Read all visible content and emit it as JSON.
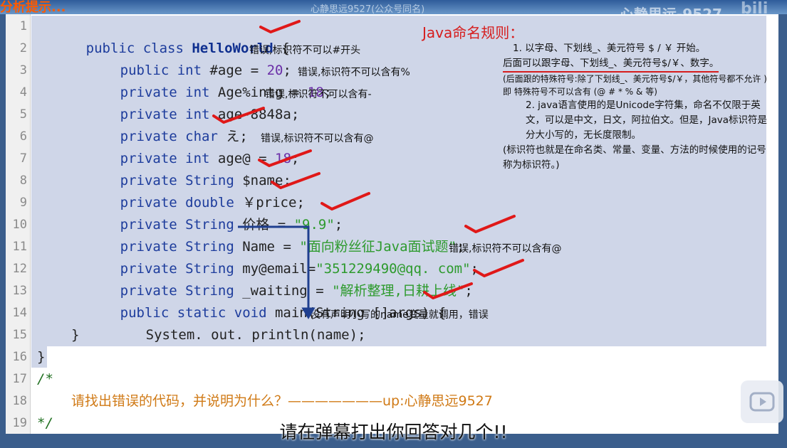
{
  "header": {
    "partial_title": "分析提示...",
    "watermark_center": "心静思远9527(公众号同名)",
    "watermark_right": "心静思远-9527",
    "watermark_logo": "bili"
  },
  "code_lines": [
    {
      "ln": "1"
    },
    {
      "ln": "2"
    },
    {
      "ln": "3"
    },
    {
      "ln": "4"
    },
    {
      "ln": "5"
    },
    {
      "ln": "6"
    },
    {
      "ln": "7"
    },
    {
      "ln": "8"
    },
    {
      "ln": "9"
    },
    {
      "ln": "10"
    },
    {
      "ln": "11"
    },
    {
      "ln": "12"
    },
    {
      "ln": "13"
    },
    {
      "ln": "14"
    },
    {
      "ln": "15"
    },
    {
      "ln": "16"
    },
    {
      "ln": "17"
    },
    {
      "ln": "18"
    },
    {
      "ln": "19"
    }
  ],
  "code": {
    "l1": {
      "a": "public class ",
      "b": "HelloWorld",
      "c": " {"
    },
    "l2": {
      "a": "public int ",
      "b": "#age",
      "c": " = ",
      "d": "20",
      "e": ";"
    },
    "l3": {
      "a": "private int ",
      "b": "Age%intg",
      "c": " = ",
      "d": "18",
      "e": ";"
    },
    "l4": {
      "a": "private int ",
      "b": "age-8848a",
      "c": ";"
    },
    "l5": {
      "a": "private char ",
      "b": "え",
      "c": ";"
    },
    "l6": {
      "a": "private int ",
      "b": "age@",
      "c": " = ",
      "d": "18",
      "e": ";"
    },
    "l7": {
      "a": "private String ",
      "b": "$name",
      "c": ";"
    },
    "l8": {
      "a": "private double ",
      "b": "￥price",
      "c": ";"
    },
    "l9": {
      "a": "private String ",
      "b": "价格",
      "c": " = ",
      "d": "\"9.9\"",
      "e": ";"
    },
    "l10": {
      "a": "private String ",
      "b": "Name",
      "c": " = ",
      "d": "\"面向粉丝征Java面试题\"",
      "e": ";"
    },
    "l11": {
      "a": "private String ",
      "b": "my@email",
      "c": "=",
      "d": "\"351229490@qq. com\"",
      "e": ";"
    },
    "l12": {
      "a": "private String ",
      "b": "_waiting",
      "c": " = ",
      "d": "\"解析整理,日耕上线\"",
      "e": ";"
    },
    "l13": {
      "a": "public static void ",
      "b": "main(String []args) {"
    },
    "l14": {
      "a": "System. out. println(name)",
      "b": ";"
    },
    "l15": {
      "a": "}"
    },
    "l16": {
      "a": "}"
    },
    "l17": {
      "a": "/*"
    },
    "l18": {
      "a": "请找出错误的代码，并说明为什么？———————up:心静思远9527"
    },
    "l19": {
      "a": "*/"
    }
  },
  "annotations": {
    "l2": "错误,标识符不可以#开头",
    "l3": "错误,标识符不可以含有%",
    "l4": "错误,标识符不可以含有-",
    "l6": "错误,标识符不可以含有@",
    "l11": "错误,标识符不可以含有@",
    "l14": "没有声明小写的name变量就调用，错误"
  },
  "rules": {
    "title": "Java命名规则：",
    "p1": "1. 以字母、下划线_、美元符号 $ / ￥ 开始。",
    "p2": "后面可以跟字母、下划线_、美元符号$/￥、数字。",
    "p3": "(后面跟的特殊符号:除了下划线_、美元符号$/￥，其他符号都不允许 )即 特殊符号不可以含有 (@ # * % & 等)",
    "p4": "2. java语言使用的是Unicode字符集，命名不仅限于英文，可以是中文，日文，阿拉伯文。但是，Java标识符是分大小写的，无长度限制。",
    "p5": "(标识符也就是在命名类、常量、变量、方法的时候使用的记号称为标识符。)"
  },
  "subtitle": "请在弹幕打出你回答对几个!!",
  "colors": {
    "tick": "#e01818",
    "arrow": "#1f3f8f",
    "selection": "#cfd6e8"
  }
}
